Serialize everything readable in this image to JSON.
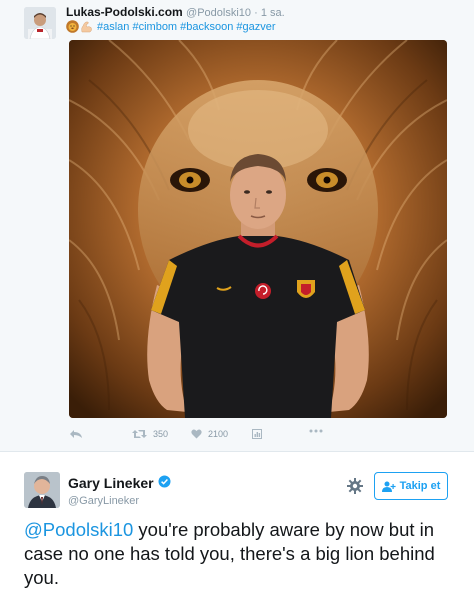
{
  "quoted_tweet": {
    "author_name": "Lukas-Podolski.com",
    "author_handle": "@Podolski10",
    "time_separator": " · ",
    "time": "1 sa.",
    "hashtags": "#aslan #cimbom #backsoon #gazver",
    "emoji": [
      "lion-face-emoji",
      "flexed-biceps-emoji"
    ],
    "actions": {
      "retweet_count": "350",
      "like_count": "2100"
    }
  },
  "main_tweet": {
    "author_name": "Gary Lineker",
    "author_handle": "@GaryLineker",
    "follow_label": "Takip et",
    "text_mention": "@Podolski10",
    "text_body": " you're probably aware by now but in case no one has told you, there's a big lion behind you."
  },
  "colors": {
    "link_blue": "#1b95e0",
    "brand_blue": "#1da1f2",
    "muted": "#8899a6",
    "quoted_bg": "#f5f8fa"
  }
}
